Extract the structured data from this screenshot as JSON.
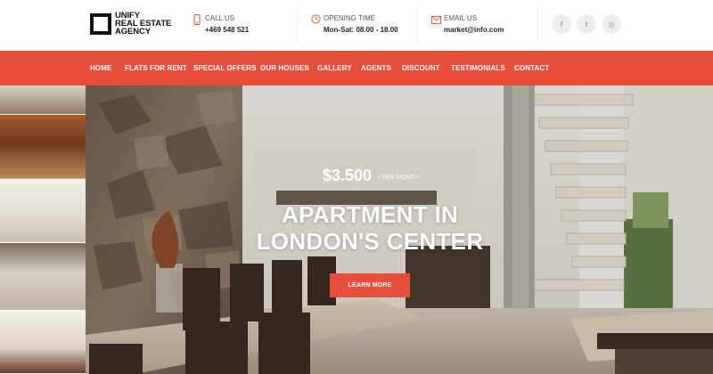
{
  "brand": {
    "logo_lines": [
      "UNIFY",
      "REAL ESTATE",
      "AGENCY"
    ]
  },
  "contacts": [
    {
      "icon": "phone-icon",
      "label": "CALL US",
      "value": "+469 548 521"
    },
    {
      "icon": "clock-icon",
      "label": "OPENING TIME",
      "value": "Mon-Sat: 08.00 - 18.00"
    },
    {
      "icon": "envelope-icon",
      "label": "EMAIL US",
      "value": "market@info.com"
    }
  ],
  "social": [
    {
      "icon": "facebook-icon",
      "glyph": "f"
    },
    {
      "icon": "twitter-icon",
      "glyph": "t"
    },
    {
      "icon": "instagram-icon",
      "glyph": "◎"
    }
  ],
  "nav": {
    "items": [
      "HOME",
      "FLATS FOR RENT",
      "SPECIAL OFFERS",
      "OUR HOUSES",
      "GALLERY",
      "AGENTS",
      "DISCOUNT",
      "TESTIMONIALS",
      "CONTACT"
    ]
  },
  "hero": {
    "price": "$3.500",
    "price_suffix": "/ PER MONTH",
    "title_line1": "APARTMENT IN",
    "title_line2": "LONDON'S CENTER",
    "cta_label": "LEARN MORE"
  },
  "colors": {
    "accent": "#e84e3c",
    "text_dark": "#222222"
  }
}
